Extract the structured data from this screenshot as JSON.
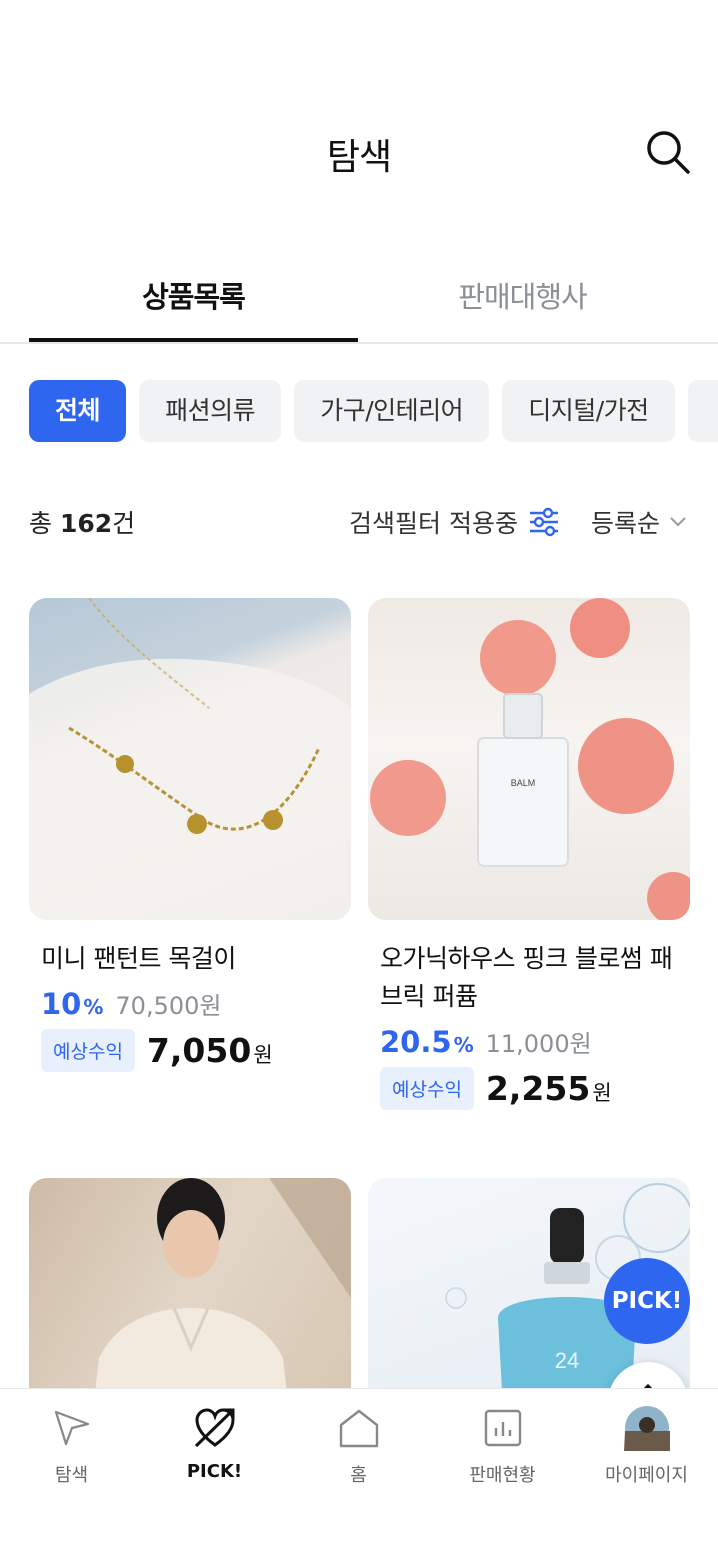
{
  "header": {
    "title": "탐색"
  },
  "tabs": [
    {
      "label": "상품목록"
    },
    {
      "label": "판매대행사"
    }
  ],
  "chips": [
    {
      "label": "전체"
    },
    {
      "label": "패션의류"
    },
    {
      "label": "가구/인테리어"
    },
    {
      "label": "디지털/가전"
    }
  ],
  "summary": {
    "count_prefix": "총",
    "count": "162",
    "count_suffix": "건",
    "filter_label": "검색필터 적용중",
    "sort_label": "등록순"
  },
  "products": [
    {
      "name": "미니 팬턴트 목걸이",
      "rate": "10",
      "rate_unit": "%",
      "original_price": "70,500원",
      "profit_badge": "예상수익",
      "profit": "7,050",
      "profit_unit": "원"
    },
    {
      "name": "오가닉하우스 핑크 블로썸 패브릭 퍼퓸",
      "rate": "20.5",
      "rate_unit": "%",
      "original_price": "11,000원",
      "profit_badge": "예상수익",
      "profit": "2,255",
      "profit_unit": "원",
      "bottle_label": "BALM"
    },
    {
      "name": ""
    },
    {
      "name": "",
      "bottle_label": "24"
    }
  ],
  "fab": {
    "pick_label": "PICK!"
  },
  "bottom_nav": [
    {
      "label": "탐색"
    },
    {
      "label": "PICK!"
    },
    {
      "label": "홈"
    },
    {
      "label": "판매현황"
    },
    {
      "label": "마이페이지"
    }
  ],
  "colors": {
    "accent": "#2f66f0",
    "chip_bg": "#f1f2f4",
    "badge_bg": "#e8f0fe"
  }
}
